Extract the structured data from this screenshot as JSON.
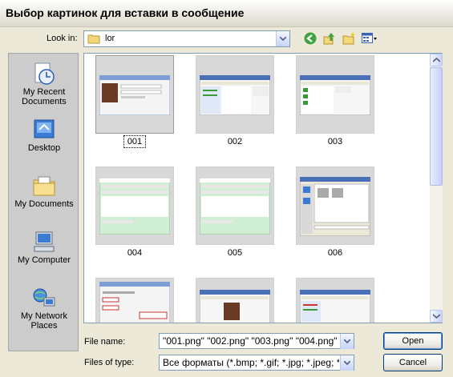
{
  "window": {
    "title": "Выбор картинок для вставки в сообщение"
  },
  "lookin": {
    "label": "Look in:",
    "value": "lor"
  },
  "toolbar": {
    "back_icon": "back-arrow-icon",
    "up_icon": "up-folder-icon",
    "new_folder_icon": "new-folder-icon",
    "views_icon": "views-menu-icon"
  },
  "places": [
    {
      "label": "My Recent Documents"
    },
    {
      "label": "Desktop"
    },
    {
      "label": "My Documents"
    },
    {
      "label": "My Computer"
    },
    {
      "label": "My Network Places"
    }
  ],
  "files": [
    {
      "name": "001"
    },
    {
      "name": "002"
    },
    {
      "name": "003"
    },
    {
      "name": "004"
    },
    {
      "name": "005"
    },
    {
      "name": "006"
    },
    {
      "name": ""
    },
    {
      "name": ""
    },
    {
      "name": ""
    }
  ],
  "filename": {
    "label": "File name:",
    "value": "\"001.png\" \"002.png\" \"003.png\" \"004.png\" \"0"
  },
  "filetype": {
    "label": "Files of type:",
    "value": "Все форматы (*.bmp; *.gif; *.jpg; *.jpeg; *.png;"
  },
  "buttons": {
    "open": "Open",
    "cancel": "Cancel"
  },
  "colors": {
    "accent": "#316ac5",
    "thumb_green": "#cfeed3"
  }
}
